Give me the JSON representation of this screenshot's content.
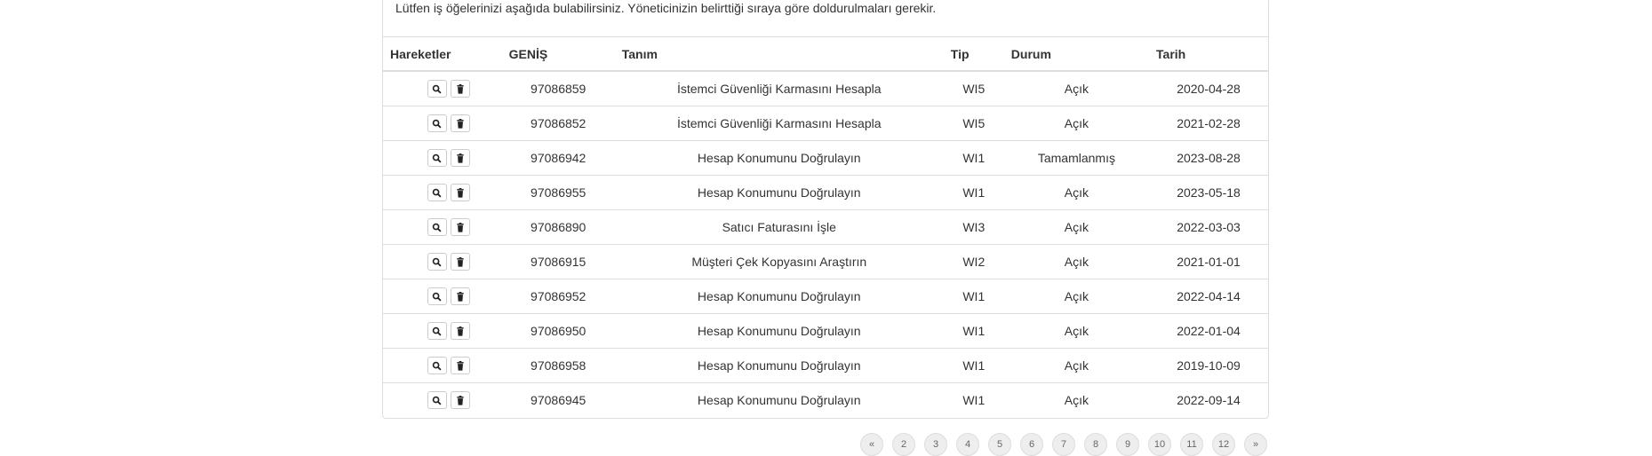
{
  "intro_text": "Lütfen iş öğelerinizi aşağıda bulabilirsiniz. Yöneticinizin belirttiği sıraya göre doldurulmaları gerekir.",
  "table": {
    "headers": {
      "actions": "Hareketler",
      "id": "GENİŞ",
      "description": "Tanım",
      "type": "Tip",
      "status": "Durum",
      "date": "Tarih"
    },
    "rows": [
      {
        "id": "97086859",
        "description": "İstemci Güvenliği Karmasını Hesapla",
        "type": "WI5",
        "status": "Açık",
        "date": "2020-04-28"
      },
      {
        "id": "97086852",
        "description": "İstemci Güvenliği Karmasını Hesapla",
        "type": "WI5",
        "status": "Açık",
        "date": "2021-02-28"
      },
      {
        "id": "97086942",
        "description": "Hesap Konumunu Doğrulayın",
        "type": "WI1",
        "status": "Tamamlanmış",
        "date": "2023-08-28"
      },
      {
        "id": "97086955",
        "description": "Hesap Konumunu Doğrulayın",
        "type": "WI1",
        "status": "Açık",
        "date": "2023-05-18"
      },
      {
        "id": "97086890",
        "description": "Satıcı Faturasını İşle",
        "type": "WI3",
        "status": "Açık",
        "date": "2022-03-03"
      },
      {
        "id": "97086915",
        "description": "Müşteri Çek Kopyasını Araştırın",
        "type": "WI2",
        "status": "Açık",
        "date": "2021-01-01"
      },
      {
        "id": "97086952",
        "description": "Hesap Konumunu Doğrulayın",
        "type": "WI1",
        "status": "Açık",
        "date": "2022-04-14"
      },
      {
        "id": "97086950",
        "description": "Hesap Konumunu Doğrulayın",
        "type": "WI1",
        "status": "Açık",
        "date": "2022-01-04"
      },
      {
        "id": "97086958",
        "description": "Hesap Konumunu Doğrulayın",
        "type": "WI1",
        "status": "Açık",
        "date": "2019-10-09"
      },
      {
        "id": "97086945",
        "description": "Hesap Konumunu Doğrulayın",
        "type": "WI1",
        "status": "Açık",
        "date": "2022-09-14"
      }
    ],
    "action_icons": [
      "search-icon",
      "trash-icon"
    ]
  },
  "pagination": {
    "pages": [
      "«",
      "2",
      "3",
      "4",
      "5",
      "6",
      "7",
      "8",
      "9",
      "10",
      "11",
      "12",
      "»"
    ]
  }
}
